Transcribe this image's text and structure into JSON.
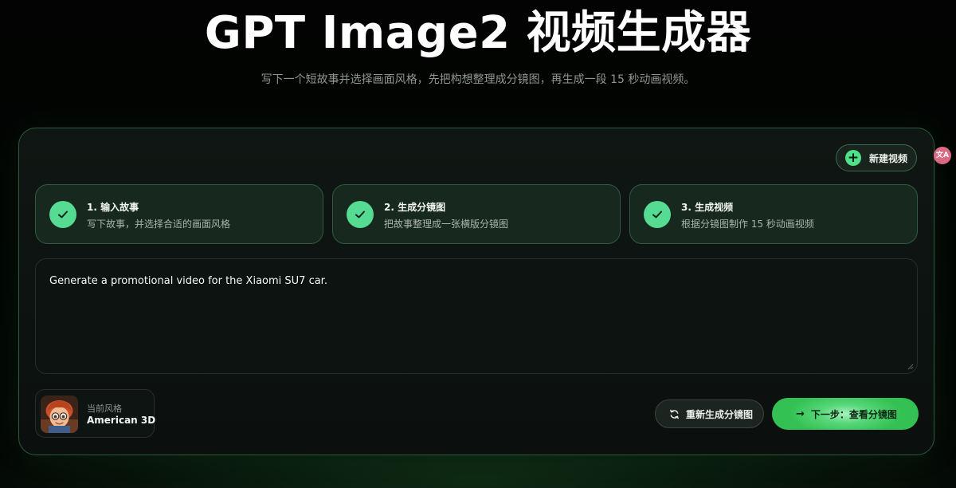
{
  "header": {
    "title": "GPT Image2 视频生成器",
    "subtitle": "写下一个短故事并选择画面风格，先把构想整理成分镜图，再生成一段 15 秒动画视频。"
  },
  "toolbar": {
    "new_video_label": "新建视频",
    "new_video_icon": "plus-circle-icon",
    "translate_icon_text": "文A"
  },
  "steps": [
    {
      "title": "1. 输入故事",
      "desc": "写下故事，并选择合适的画面风格",
      "status": "completed",
      "icon": "check-icon"
    },
    {
      "title": "2. 生成分镜图",
      "desc": "把故事整理成一张横版分镜图",
      "status": "completed",
      "icon": "check-icon"
    },
    {
      "title": "3. 生成视频",
      "desc": "根据分镜图制作 15 秒动画视频",
      "status": "completed",
      "icon": "check-icon"
    }
  ],
  "story": {
    "value": "Generate a promotional video for the Xiaomi SU7 car."
  },
  "style": {
    "caption": "当前风格",
    "name": "American 3D"
  },
  "actions": {
    "regenerate_label": "重新生成分镜图",
    "regenerate_icon": "refresh-icon",
    "next_label": "下一步：查看分镜图",
    "next_icon": "arrow-right-icon"
  },
  "colors": {
    "accent": "#55dc92",
    "next_button": "#3cc45a",
    "background": "#030504"
  }
}
